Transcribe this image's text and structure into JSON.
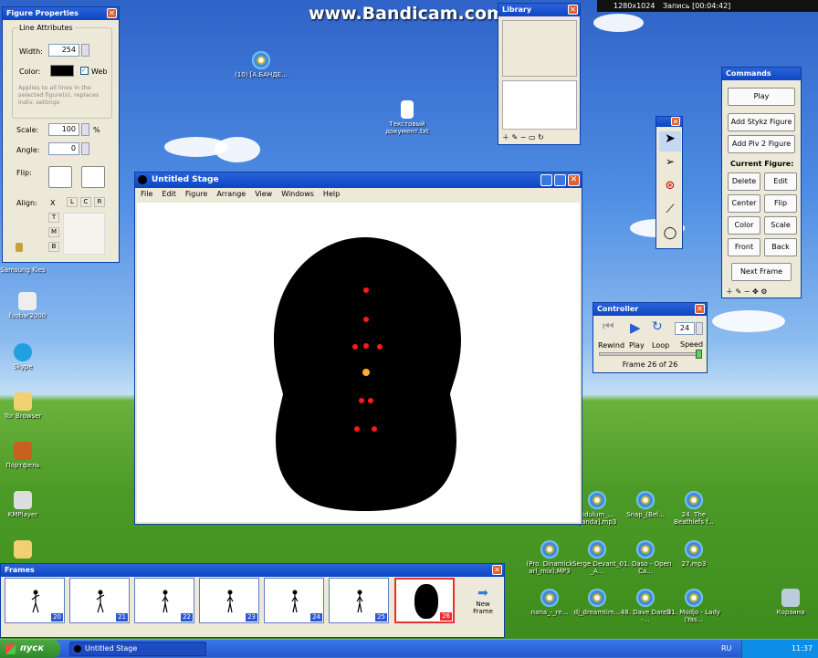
{
  "watermark": "www.Bandicam.com",
  "recorder": {
    "resolution": "1280x1024",
    "status": "Запись [00:04:42]"
  },
  "figure_properties": {
    "title": "Figure Properties",
    "group": "Line Attributes",
    "width_label": "Width:",
    "width_value": "254",
    "color_label": "Color:",
    "web_label": "Web",
    "hint": "Applies to all lines in the selected figure(s), replaces indiv. settings",
    "scale_label": "Scale:",
    "scale_value": "100",
    "percent": "%",
    "angle_label": "Angle:",
    "angle_value": "0",
    "flip_label": "Flip:",
    "align_label": "Align:",
    "align_x": "X",
    "align_l": "L",
    "align_c": "C",
    "align_r": "R",
    "align_t": "T",
    "align_m": "M",
    "align_b": "B"
  },
  "library": {
    "title": "Library"
  },
  "stage": {
    "title": "Untitled Stage",
    "menu": [
      "File",
      "Edit",
      "Figure",
      "Arrange",
      "View",
      "Windows",
      "Help"
    ]
  },
  "commands": {
    "title": "Commands",
    "play": "Play",
    "add_stykz": "Add Stykz Figure",
    "add_piv": "Add Piv 2 Figure",
    "current_figure": "Current Figure:",
    "delete": "Delete",
    "edit": "Edit",
    "center": "Center",
    "flip": "Flip",
    "color": "Color",
    "scale": "Scale",
    "front": "Front",
    "back": "Back",
    "next_frame": "Next Frame"
  },
  "controller": {
    "title": "Controller",
    "rewind": "Rewind",
    "play": "Play",
    "loop": "Loop",
    "speed_value": "24",
    "speed_label": "Speed",
    "frame_status": "Frame 26 of 26"
  },
  "frames": {
    "title": "Frames",
    "numbers": [
      "20",
      "21",
      "22",
      "23",
      "24",
      "25",
      "26"
    ],
    "new_frame": "New Frame"
  },
  "desktop_icons": [
    {
      "label": "(10) [А.БАНДЕ..."
    },
    {
      "label": "Текстовый документ.txt"
    },
    {
      "label": "Samsung Kies"
    },
    {
      "label": "foobar2000"
    },
    {
      "label": "Skype"
    },
    {
      "label": "Tor Browser"
    },
    {
      "label": "Портфель"
    },
    {
      "label": "KMPlayer"
    },
    {
      "label": "ndulum_... panda].mp3"
    },
    {
      "label": "Snap_(Bel..."
    },
    {
      "label": "24. The Beathiefs f..."
    },
    {
      "label": "(Pro. Dinamick arl_mix).MP3"
    },
    {
      "label": "Serge Devant_-_A..."
    },
    {
      "label": "01. Daso - Open Ca..."
    },
    {
      "label": "27.mp3"
    },
    {
      "label": "nana_-_re..."
    },
    {
      "label": "dj_dreamtim..."
    },
    {
      "label": "48. Dave Darell -..."
    },
    {
      "label": "31. Modjo - Lady (Yas..."
    },
    {
      "label": "Корзина"
    }
  ],
  "taskbar": {
    "start": "пуск",
    "task": "Untitled Stage",
    "lang": "RU",
    "clock": "11:37"
  }
}
